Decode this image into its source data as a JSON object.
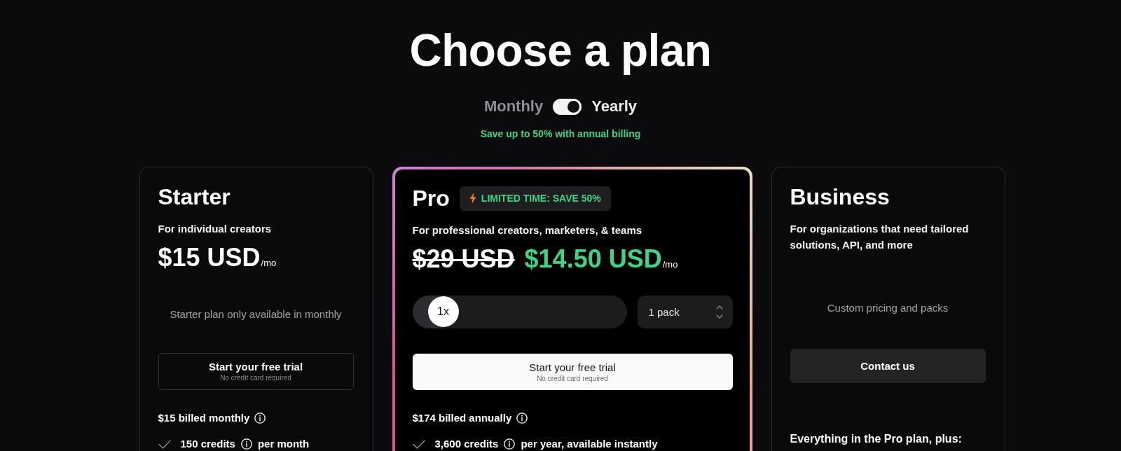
{
  "title": "Choose a plan",
  "billing": {
    "options": [
      {
        "label": "Monthly",
        "selected": false
      },
      {
        "label": "Yearly",
        "selected": true
      }
    ],
    "note": "Save up to 50% with annual billing"
  },
  "plans": [
    {
      "name": "Starter",
      "featured": false,
      "description": "For individual creators",
      "price": "$15 USD",
      "period": "/mo",
      "note": "Starter plan only available in monthly",
      "button": {
        "kind": "outline",
        "label": "Start your free trial",
        "sublabel": "No credit card required"
      },
      "billed": "$15 billed monthly",
      "features": [
        {
          "text": "150 credits",
          "suffix": "per month"
        }
      ]
    },
    {
      "name": "Pro",
      "featured": true,
      "badge": "LIMITED TIME: SAVE 50%",
      "description": "For professional creators, marketers, & teams",
      "old_price": "$29 USD",
      "price": "$14.50 USD",
      "period": "/mo",
      "quantity": {
        "slider": {
          "label": "1x",
          "level": 0
        },
        "stepper": {
          "value": "1 pack"
        }
      },
      "button": {
        "kind": "primary",
        "label": "Start your free trial",
        "sublabel": "No credit card required"
      },
      "billed": "$174 billed annually",
      "features": [
        {
          "text": "3,600 credits",
          "suffix": "per year, available instantly"
        }
      ]
    },
    {
      "name": "Business",
      "featured": false,
      "description": "For organizations that need tailored solutions, API, and more",
      "note": "Custom pricing and packs",
      "button": {
        "kind": "secondary",
        "label": "Contact us"
      },
      "features_heading": "Everything in the Pro plan, plus:"
    }
  ]
}
